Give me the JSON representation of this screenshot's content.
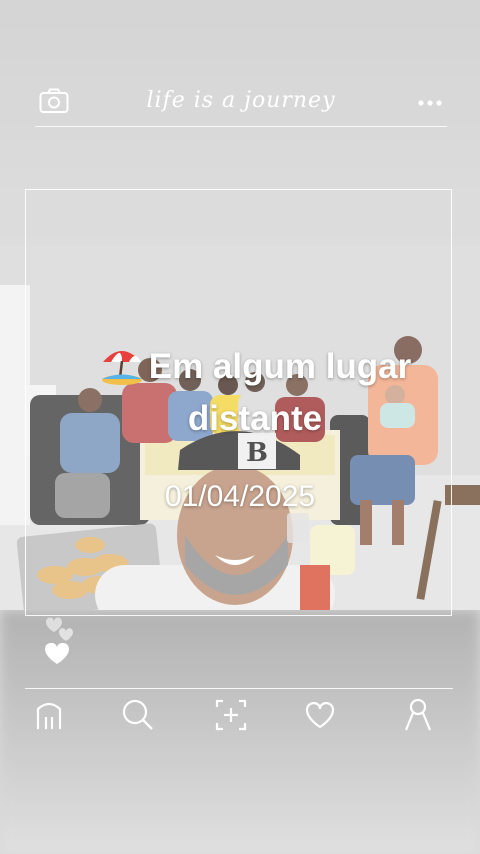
{
  "header": {
    "title": "life is a journey",
    "camera_icon": "camera-icon",
    "more_icon": "more-dots-icon"
  },
  "post": {
    "caption_emoji": "beach-umbrella",
    "caption": "Em algum lugar distante",
    "date": "01/04/2025"
  },
  "reactions": {
    "icon": "heart-icon"
  },
  "nav": {
    "items": [
      {
        "name": "home",
        "icon": "home-icon"
      },
      {
        "name": "search",
        "icon": "search-icon"
      },
      {
        "name": "add",
        "icon": "add-post-icon"
      },
      {
        "name": "likes",
        "icon": "heart-icon"
      },
      {
        "name": "profile",
        "icon": "profile-icon"
      }
    ]
  },
  "colors": {
    "overlay_white": "#ffffff",
    "wall": "#d9d9d9",
    "floor": "#e3e3e3"
  }
}
